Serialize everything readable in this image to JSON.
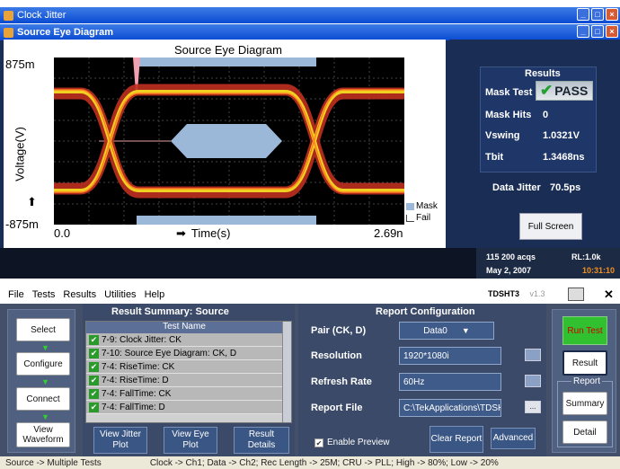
{
  "outer_window": {
    "title": "Clock Jitter"
  },
  "inner_window": {
    "title": "Source Eye Diagram"
  },
  "plot": {
    "title": "Source Eye Diagram",
    "y_top": "875m",
    "y_bottom": "-875m",
    "y_label": "Voltage(V)",
    "x_left": "0.0",
    "x_right": "2.69n",
    "x_label": "Time(s)",
    "legend_mask": "Mask",
    "legend_fail": "Fail"
  },
  "results": {
    "header": "Results",
    "mask_test_label": "Mask Test",
    "mask_test_value": "PASS",
    "mask_hits_label": "Mask Hits",
    "mask_hits_value": "0",
    "vswing_label": "Vswing",
    "vswing_value": "1.0321V",
    "tbit_label": "Tbit",
    "tbit_value": "1.3468ns",
    "data_jitter_label": "Data Jitter",
    "data_jitter_value": "70.5ps",
    "full_screen": "Full Screen"
  },
  "acq": {
    "acqs": "115 200 acqs",
    "rl": "RL:1.0k",
    "date": "May 2, 2007",
    "time": "10:31:10"
  },
  "menu": {
    "file": "File",
    "tests": "Tests",
    "results": "Results",
    "utilities": "Utilities",
    "help": "Help",
    "app_name": "TDSHT3",
    "version": "v1.3"
  },
  "left_buttons": {
    "select": "Select",
    "configure": "Configure",
    "connect": "Connect",
    "view_waveform": "View Waveform"
  },
  "result_summary": {
    "title": "Result Summary: Source",
    "column": "Test Name",
    "rows": [
      "7-9: Clock Jitter: CK",
      "7-10: Source Eye Diagram: CK, D",
      "7-4: RiseTime: CK",
      "7-4: RiseTime: D",
      "7-4: FallTime: CK",
      "7-4: FallTime: D"
    ]
  },
  "summary_buttons": {
    "jitter_plot": "View Jitter Plot",
    "eye_plot": "View Eye Plot",
    "result_details": "Result Details"
  },
  "report_config": {
    "title": "Report Configuration",
    "pair_label": "Pair (CK, D)",
    "pair_value": "Data0",
    "resolution_label": "Resolution",
    "resolution_value": "1920*1080i",
    "refresh_label": "Refresh Rate",
    "refresh_value": "60Hz",
    "report_file_label": "Report File",
    "report_file_value": "C:\\TekApplications\\TDSHT",
    "enable_preview": "Enable Preview",
    "clear_report": "Clear Report",
    "advanced": "Advanced"
  },
  "right_buttons": {
    "run_test": "Run Test",
    "result": "Result",
    "report_group": "Report",
    "summary": "Summary",
    "detail": "Detail"
  },
  "footer": {
    "left": "Source -> Multiple Tests",
    "right": "Clock -> Ch1; Data -> Ch2; Rec Length -> 25M; CRU -> PLL; High -> 80%; Low -> 20%"
  }
}
